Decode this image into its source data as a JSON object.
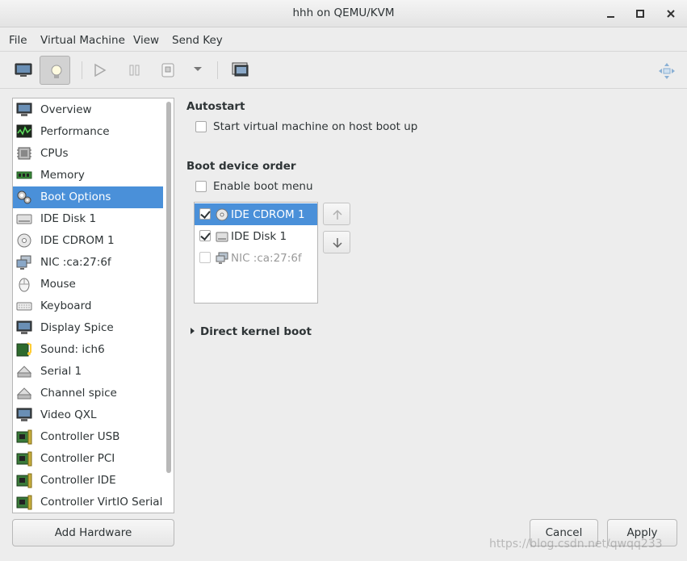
{
  "window": {
    "title": "hhh on QEMU/KVM",
    "minimize": "_",
    "maximize": "□",
    "close": "×"
  },
  "menu": [
    "File",
    "Virtual Machine",
    "View",
    "Send Key"
  ],
  "toolbar": {
    "icons": [
      "console-icon",
      "details-icon",
      "run-icon",
      "pause-icon",
      "shutdown-icon",
      "dropdown-icon",
      "snapshots-icon",
      "fullscreen-icon"
    ]
  },
  "sidebar": {
    "items": [
      {
        "label": "Overview",
        "icon": "monitor-icon"
      },
      {
        "label": "Performance",
        "icon": "performance-icon"
      },
      {
        "label": "CPUs",
        "icon": "cpu-icon"
      },
      {
        "label": "Memory",
        "icon": "memory-icon"
      },
      {
        "label": "Boot Options",
        "icon": "gears-icon",
        "selected": true
      },
      {
        "label": "IDE Disk 1",
        "icon": "disk-icon"
      },
      {
        "label": "IDE CDROM 1",
        "icon": "cdrom-icon"
      },
      {
        "label": "NIC :ca:27:6f",
        "icon": "network-icon"
      },
      {
        "label": "Mouse",
        "icon": "mouse-icon"
      },
      {
        "label": "Keyboard",
        "icon": "keyboard-icon"
      },
      {
        "label": "Display Spice",
        "icon": "display-icon"
      },
      {
        "label": "Sound: ich6",
        "icon": "sound-icon"
      },
      {
        "label": "Serial 1",
        "icon": "serial-icon"
      },
      {
        "label": "Channel spice",
        "icon": "channel-icon"
      },
      {
        "label": "Video QXL",
        "icon": "video-icon"
      },
      {
        "label": "Controller USB",
        "icon": "controller-icon"
      },
      {
        "label": "Controller PCI",
        "icon": "controller-icon"
      },
      {
        "label": "Controller IDE",
        "icon": "controller-icon"
      },
      {
        "label": "Controller VirtIO Serial",
        "icon": "controller-icon"
      }
    ],
    "add_hardware": "Add Hardware"
  },
  "autostart": {
    "title": "Autostart",
    "checkbox_label": "Start virtual machine on host boot up",
    "checked": false
  },
  "boot": {
    "title": "Boot device order",
    "enable_menu_label": "Enable boot menu",
    "enable_menu_checked": false,
    "devices": [
      {
        "label": "IDE CDROM 1",
        "checked": true,
        "selected": true,
        "icon": "cdrom-icon"
      },
      {
        "label": "IDE Disk 1",
        "checked": true,
        "selected": false,
        "icon": "disk-icon"
      },
      {
        "label": "NIC :ca:27:6f",
        "checked": false,
        "selected": false,
        "disabled": true,
        "icon": "network-icon"
      }
    ]
  },
  "direct_kernel_boot": {
    "label": "Direct kernel boot",
    "expanded": false
  },
  "footer": {
    "cancel": "Cancel",
    "apply": "Apply",
    "watermark": "https://blog.csdn.net/qwqq233"
  },
  "colors": {
    "selection": "#4a90d9"
  }
}
